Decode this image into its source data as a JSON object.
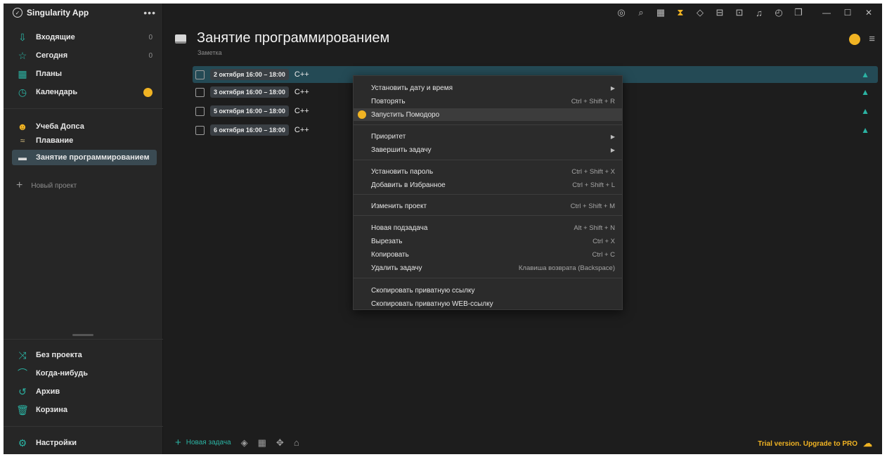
{
  "app": {
    "title": "Singularity App",
    "more_label": "•••"
  },
  "sidebar": {
    "top_items": [
      {
        "label": "Входящие",
        "count": "0",
        "icon": "inbox-icon"
      },
      {
        "label": "Сегодня",
        "count": "0",
        "icon": "star-icon"
      },
      {
        "label": "Планы",
        "count": "",
        "icon": "plans-icon"
      },
      {
        "label": "Календарь",
        "count": "",
        "icon": "calendar-clock-icon"
      }
    ],
    "projects": [
      {
        "label": "Учеба Допса",
        "icon": "emoji-icon"
      },
      {
        "label": "Плавание",
        "icon": "swimmer-icon"
      },
      {
        "label": "Занятие программированием",
        "icon": "laptop-icon"
      }
    ],
    "new_project": "Новый проект",
    "bottom_items": [
      {
        "label": "Без проекта",
        "icon": "shuffle-icon"
      },
      {
        "label": "Когда-нибудь",
        "icon": "rainbow-icon"
      },
      {
        "label": "Архив",
        "icon": "history-icon"
      },
      {
        "label": "Корзина",
        "icon": "trash-icon"
      }
    ],
    "settings": "Настройки"
  },
  "main": {
    "title": "Занятие программированием",
    "subtitle": "Заметка"
  },
  "tasks": [
    {
      "date": "2 октября 16:00 – 18:00",
      "name": "C++"
    },
    {
      "date": "3 октября 16:00 – 18:00",
      "name": "C++"
    },
    {
      "date": "5 октября 16:00 – 18:00",
      "name": "C++"
    },
    {
      "date": "6 октября 16:00 – 18:00",
      "name": "C++"
    }
  ],
  "context_menu": {
    "items": [
      {
        "label": "Установить дату и время",
        "shortcut": "",
        "submenu": true
      },
      {
        "label": "Повторять",
        "shortcut": "Ctrl + Shift + R"
      },
      {
        "label": "Запустить Помодоро",
        "shortcut": ""
      },
      {
        "label": "Приоритет",
        "shortcut": "",
        "submenu": true
      },
      {
        "label": "Завершить задачу",
        "shortcut": "",
        "submenu": true
      },
      {
        "label": "Установить пароль",
        "shortcut": "Ctrl + Shift + X"
      },
      {
        "label": "Добавить в Избранное",
        "shortcut": "Ctrl + Shift + L"
      },
      {
        "label": "Изменить проект",
        "shortcut": "Ctrl + Shift + M"
      },
      {
        "label": "Новая подзадача",
        "shortcut": "Alt + Shift + N"
      },
      {
        "label": "Вырезать",
        "shortcut": "Ctrl + X"
      },
      {
        "label": "Копировать",
        "shortcut": "Ctrl + C"
      },
      {
        "label": "Удалить задачу",
        "shortcut": "Клавиша возврата (Backspace)"
      },
      {
        "label": "Скопировать приватную ссылку",
        "shortcut": ""
      },
      {
        "label": "Скопировать приватную WEB-ссылку",
        "shortcut": ""
      }
    ]
  },
  "bottom": {
    "new_task": "Новая задача",
    "trial": "Trial version. Upgrade to PRO"
  },
  "colors": {
    "accent": "#2bb3a3",
    "pomodoro": "#f0b323",
    "background": "#1d1d1d",
    "sidebar": "#262626"
  }
}
